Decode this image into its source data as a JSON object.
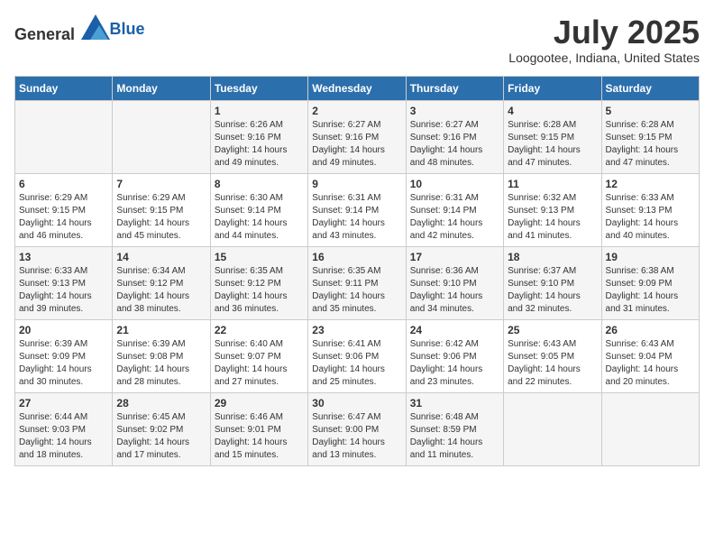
{
  "header": {
    "logo_general": "General",
    "logo_blue": "Blue",
    "title": "July 2025",
    "subtitle": "Loogootee, Indiana, United States"
  },
  "weekdays": [
    "Sunday",
    "Monday",
    "Tuesday",
    "Wednesday",
    "Thursday",
    "Friday",
    "Saturday"
  ],
  "weeks": [
    [
      {
        "day": "",
        "detail": ""
      },
      {
        "day": "",
        "detail": ""
      },
      {
        "day": "1",
        "detail": "Sunrise: 6:26 AM\nSunset: 9:16 PM\nDaylight: 14 hours\nand 49 minutes."
      },
      {
        "day": "2",
        "detail": "Sunrise: 6:27 AM\nSunset: 9:16 PM\nDaylight: 14 hours\nand 49 minutes."
      },
      {
        "day": "3",
        "detail": "Sunrise: 6:27 AM\nSunset: 9:16 PM\nDaylight: 14 hours\nand 48 minutes."
      },
      {
        "day": "4",
        "detail": "Sunrise: 6:28 AM\nSunset: 9:15 PM\nDaylight: 14 hours\nand 47 minutes."
      },
      {
        "day": "5",
        "detail": "Sunrise: 6:28 AM\nSunset: 9:15 PM\nDaylight: 14 hours\nand 47 minutes."
      }
    ],
    [
      {
        "day": "6",
        "detail": "Sunrise: 6:29 AM\nSunset: 9:15 PM\nDaylight: 14 hours\nand 46 minutes."
      },
      {
        "day": "7",
        "detail": "Sunrise: 6:29 AM\nSunset: 9:15 PM\nDaylight: 14 hours\nand 45 minutes."
      },
      {
        "day": "8",
        "detail": "Sunrise: 6:30 AM\nSunset: 9:14 PM\nDaylight: 14 hours\nand 44 minutes."
      },
      {
        "day": "9",
        "detail": "Sunrise: 6:31 AM\nSunset: 9:14 PM\nDaylight: 14 hours\nand 43 minutes."
      },
      {
        "day": "10",
        "detail": "Sunrise: 6:31 AM\nSunset: 9:14 PM\nDaylight: 14 hours\nand 42 minutes."
      },
      {
        "day": "11",
        "detail": "Sunrise: 6:32 AM\nSunset: 9:13 PM\nDaylight: 14 hours\nand 41 minutes."
      },
      {
        "day": "12",
        "detail": "Sunrise: 6:33 AM\nSunset: 9:13 PM\nDaylight: 14 hours\nand 40 minutes."
      }
    ],
    [
      {
        "day": "13",
        "detail": "Sunrise: 6:33 AM\nSunset: 9:13 PM\nDaylight: 14 hours\nand 39 minutes."
      },
      {
        "day": "14",
        "detail": "Sunrise: 6:34 AM\nSunset: 9:12 PM\nDaylight: 14 hours\nand 38 minutes."
      },
      {
        "day": "15",
        "detail": "Sunrise: 6:35 AM\nSunset: 9:12 PM\nDaylight: 14 hours\nand 36 minutes."
      },
      {
        "day": "16",
        "detail": "Sunrise: 6:35 AM\nSunset: 9:11 PM\nDaylight: 14 hours\nand 35 minutes."
      },
      {
        "day": "17",
        "detail": "Sunrise: 6:36 AM\nSunset: 9:10 PM\nDaylight: 14 hours\nand 34 minutes."
      },
      {
        "day": "18",
        "detail": "Sunrise: 6:37 AM\nSunset: 9:10 PM\nDaylight: 14 hours\nand 32 minutes."
      },
      {
        "day": "19",
        "detail": "Sunrise: 6:38 AM\nSunset: 9:09 PM\nDaylight: 14 hours\nand 31 minutes."
      }
    ],
    [
      {
        "day": "20",
        "detail": "Sunrise: 6:39 AM\nSunset: 9:09 PM\nDaylight: 14 hours\nand 30 minutes."
      },
      {
        "day": "21",
        "detail": "Sunrise: 6:39 AM\nSunset: 9:08 PM\nDaylight: 14 hours\nand 28 minutes."
      },
      {
        "day": "22",
        "detail": "Sunrise: 6:40 AM\nSunset: 9:07 PM\nDaylight: 14 hours\nand 27 minutes."
      },
      {
        "day": "23",
        "detail": "Sunrise: 6:41 AM\nSunset: 9:06 PM\nDaylight: 14 hours\nand 25 minutes."
      },
      {
        "day": "24",
        "detail": "Sunrise: 6:42 AM\nSunset: 9:06 PM\nDaylight: 14 hours\nand 23 minutes."
      },
      {
        "day": "25",
        "detail": "Sunrise: 6:43 AM\nSunset: 9:05 PM\nDaylight: 14 hours\nand 22 minutes."
      },
      {
        "day": "26",
        "detail": "Sunrise: 6:43 AM\nSunset: 9:04 PM\nDaylight: 14 hours\nand 20 minutes."
      }
    ],
    [
      {
        "day": "27",
        "detail": "Sunrise: 6:44 AM\nSunset: 9:03 PM\nDaylight: 14 hours\nand 18 minutes."
      },
      {
        "day": "28",
        "detail": "Sunrise: 6:45 AM\nSunset: 9:02 PM\nDaylight: 14 hours\nand 17 minutes."
      },
      {
        "day": "29",
        "detail": "Sunrise: 6:46 AM\nSunset: 9:01 PM\nDaylight: 14 hours\nand 15 minutes."
      },
      {
        "day": "30",
        "detail": "Sunrise: 6:47 AM\nSunset: 9:00 PM\nDaylight: 14 hours\nand 13 minutes."
      },
      {
        "day": "31",
        "detail": "Sunrise: 6:48 AM\nSunset: 8:59 PM\nDaylight: 14 hours\nand 11 minutes."
      },
      {
        "day": "",
        "detail": ""
      },
      {
        "day": "",
        "detail": ""
      }
    ]
  ]
}
